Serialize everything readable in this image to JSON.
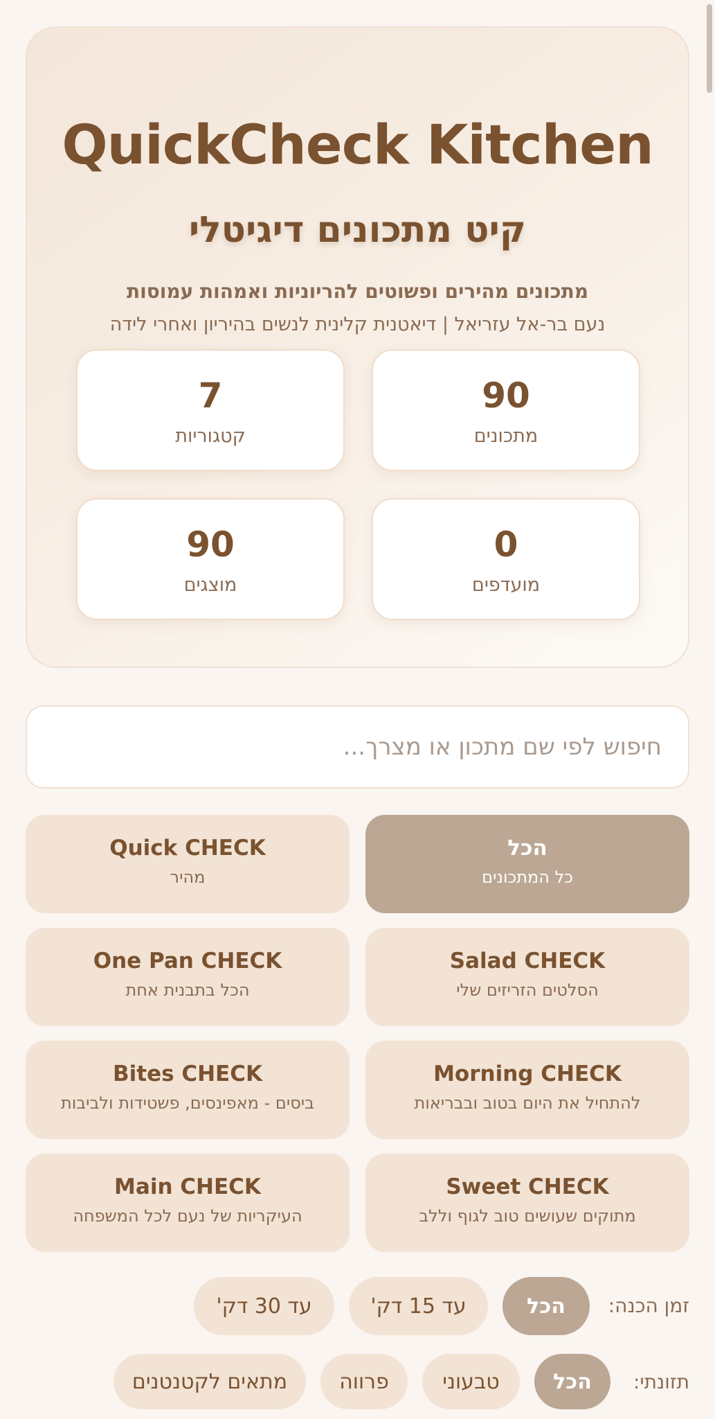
{
  "hero": {
    "title": "QuickCheck Kitchen",
    "subtitle": "קיט מתכונים דיגיטלי",
    "tagline": "מתכונים מהירים ופשוטים להריוניות ואמהות עמוסות",
    "author": "נעם בר-אל עזריאל | דיאטנית קלינית לנשים בהיריון ואחרי לידה"
  },
  "stats": [
    {
      "value": "90",
      "label": "מתכונים"
    },
    {
      "value": "7",
      "label": "קטגוריות"
    },
    {
      "value": "0",
      "label": "מועדפים"
    },
    {
      "value": "90",
      "label": "מוצגים"
    }
  ],
  "search": {
    "placeholder": "חיפוש לפי שם מתכון או מצרך...",
    "value": ""
  },
  "categories": [
    {
      "name": "הכל",
      "desc": "כל המתכונים",
      "active": true
    },
    {
      "name": "Quick CHECK",
      "desc": "מהיר"
    },
    {
      "name": "Salad CHECK",
      "desc": "הסלטים הזריזים שלי"
    },
    {
      "name": "One Pan CHECK",
      "desc": "הכל בתבנית אחת"
    },
    {
      "name": "Morning CHECK",
      "desc": "להתחיל את היום בטוב ובבריאות"
    },
    {
      "name": "Bites CHECK",
      "desc": "ביסים - מאפינסים, פשטידות ולביבות"
    },
    {
      "name": "Sweet CHECK",
      "desc": "מתוקים שעושים טוב לגוף וללב"
    },
    {
      "name": "Main CHECK",
      "desc": "העיקריות של נעם לכל המשפחה"
    }
  ],
  "filters": {
    "prep_time": {
      "label": "זמן הכנה:",
      "options": [
        "הכל",
        "עד 15 דק'",
        "עד 30 דק'"
      ],
      "selected": "הכל"
    },
    "nutrition": {
      "label": "תזונתי:",
      "options": [
        "הכל",
        "טבעוני",
        "פרווה",
        "מתאים לקטנטנים"
      ],
      "selected": "הכל"
    }
  }
}
